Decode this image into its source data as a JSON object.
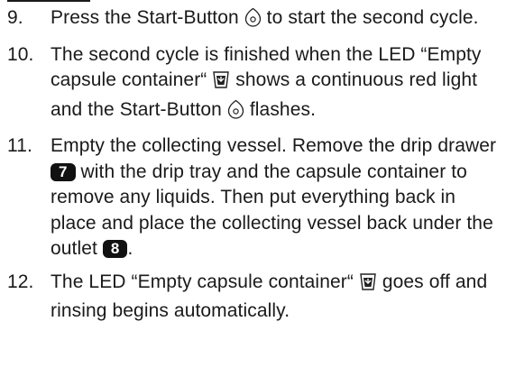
{
  "steps": [
    {
      "number": "9.",
      "parts": [
        "Press the Start-Button",
        "to start the second cycle."
      ]
    },
    {
      "number": "10.",
      "parts": [
        "The second cycle is finished when the LED “Empty capsule container“",
        "shows a continuous red light and the Start-Button",
        "flashes."
      ]
    },
    {
      "number": "11.",
      "parts": [
        "Empty the collecting vessel. Remove the drip drawer",
        "with the drip tray and the capsule container to remove any liquids. Then put everything back in place and place the collecting vessel back under the outlet",
        "."
      ],
      "badges": [
        "7",
        "8"
      ]
    },
    {
      "number": "12.",
      "parts": [
        "The LED “Empty capsule container“",
        "goes off and rinsing begins automatically."
      ]
    }
  ]
}
